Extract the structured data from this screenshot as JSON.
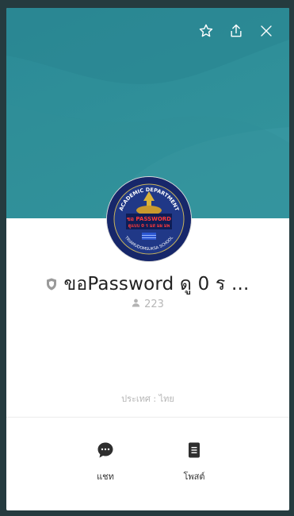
{
  "colors": {
    "cover": "#2f8f99",
    "frame": "#253b3f",
    "text_primary": "#222222",
    "text_muted": "#b5b5b5",
    "icon_dark": "#2e2e2e"
  },
  "header": {
    "actions": [
      {
        "icon": "star-outline-icon"
      },
      {
        "icon": "share-icon"
      },
      {
        "icon": "close-icon"
      }
    ]
  },
  "profile": {
    "avatar_icon": "group-avatar-emblem",
    "avatar_text": {
      "top": "ACADEMIC DEPARTMENT",
      "line1": "ขอ PASSWORD",
      "line2": "ดูแบบ 0 ร มส มผ มพ",
      "bottom": "TRIAMUDOMSUKSA SCHOOL"
    },
    "verified_icon": "shield-icon",
    "name": "ขอPassword ดู 0 ร ...",
    "member_icon": "person-icon",
    "members": "223",
    "country": "ประเทศ : ไทย"
  },
  "tabs": [
    {
      "label": "แชท",
      "icon": "chat-bubble-icon"
    },
    {
      "label": "โพสต์",
      "icon": "note-icon"
    }
  ]
}
